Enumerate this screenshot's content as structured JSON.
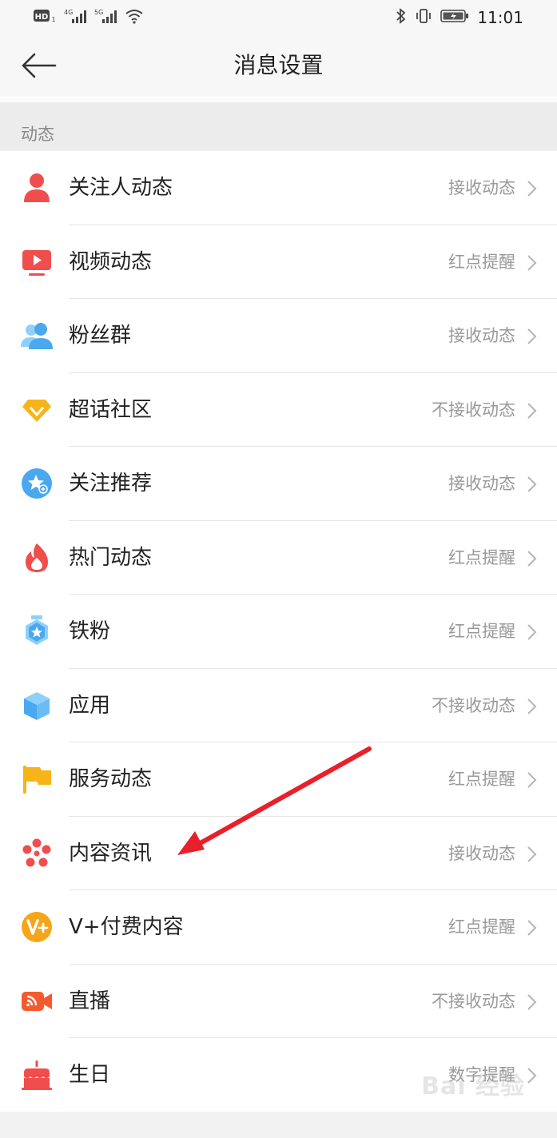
{
  "status_bar": {
    "time": "11:01",
    "network_labels": [
      "HD",
      "4G",
      "5G"
    ]
  },
  "header": {
    "title": "消息设置"
  },
  "section": {
    "title": "动态"
  },
  "items": [
    {
      "label": "关注人动态",
      "value": "接收动态",
      "icon": "person-icon",
      "color": "#f04d4d"
    },
    {
      "label": "视频动态",
      "value": "红点提醒",
      "icon": "video-icon",
      "color": "#f04d4d"
    },
    {
      "label": "粉丝群",
      "value": "接收动态",
      "icon": "fans-group-icon",
      "color": "#4aa8f0"
    },
    {
      "label": "超话社区",
      "value": "不接收动态",
      "icon": "diamond-icon",
      "color": "#f6b41a"
    },
    {
      "label": "关注推荐",
      "value": "接收动态",
      "icon": "star-plus-icon",
      "color": "#4aa8f0"
    },
    {
      "label": "热门动态",
      "value": "红点提醒",
      "icon": "flame-icon",
      "color": "#f04d4d"
    },
    {
      "label": "铁粉",
      "value": "红点提醒",
      "icon": "badge-icon",
      "color": "#4aa8f0"
    },
    {
      "label": "应用",
      "value": "不接收动态",
      "icon": "cube-icon",
      "color": "#4aa8f0"
    },
    {
      "label": "服务动态",
      "value": "红点提醒",
      "icon": "flag-icon",
      "color": "#f6b41a"
    },
    {
      "label": "内容资讯",
      "value": "接收动态",
      "icon": "flower-icon",
      "color": "#f04d4d"
    },
    {
      "label": "V+付费内容",
      "value": "红点提醒",
      "icon": "vplus-icon",
      "color": "#f6a51a"
    },
    {
      "label": "直播",
      "value": "不接收动态",
      "icon": "live-icon",
      "color": "#f35b2e"
    },
    {
      "label": "生日",
      "value": "数字提醒",
      "icon": "cake-icon",
      "color": "#f04d4d"
    }
  ],
  "annotation": {
    "arrow_color": "#e8202a"
  },
  "watermark": {
    "text": "Bai 经验"
  }
}
